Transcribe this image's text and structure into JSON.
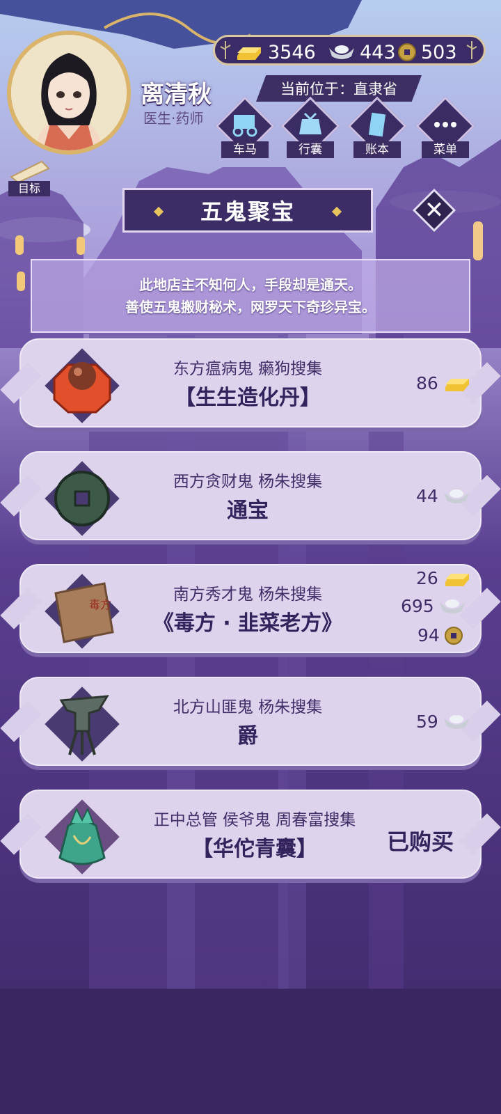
{
  "player": {
    "name": "离清秋",
    "role": "医生·药师"
  },
  "currency": {
    "gold": "3546",
    "silver": "443",
    "coin": "503"
  },
  "location": "当前位于：直隶省",
  "menu": [
    {
      "label": "车马",
      "icon": "carriage-icon"
    },
    {
      "label": "行囊",
      "icon": "bag-icon"
    },
    {
      "label": "账本",
      "icon": "ledger-icon"
    },
    {
      "label": "菜单",
      "icon": "menu-icon"
    }
  ],
  "goal_label": "目标",
  "shop": {
    "title": "五鬼聚宝",
    "description": [
      "此地店主不知何人，手段却是通天。",
      "善使五鬼搬财秘术，网罗天下奇珍异宝。"
    ]
  },
  "items": [
    {
      "subtitle": "东方瘟病鬼 癞狗搜集",
      "name": "【生生造化丹】",
      "icon": "pill-box-icon",
      "prices": [
        {
          "amount": "86",
          "currency": "gold"
        }
      ]
    },
    {
      "subtitle": "西方贪财鬼 杨朱搜集",
      "name": "通宝",
      "icon": "coin-icon",
      "prices": [
        {
          "amount": "44",
          "currency": "silver"
        }
      ]
    },
    {
      "subtitle": "南方秀才鬼 杨朱搜集",
      "name": "《毒方 · 韭菜老方》",
      "icon": "scroll-icon",
      "icon_text": "毒方",
      "prices": [
        {
          "amount": "26",
          "currency": "gold"
        },
        {
          "amount": "695",
          "currency": "silver"
        },
        {
          "amount": "94",
          "currency": "coin"
        }
      ]
    },
    {
      "subtitle": "北方山匪鬼 杨朱搜集",
      "name": "爵",
      "icon": "bronze-vessel-icon",
      "prices": [
        {
          "amount": "59",
          "currency": "silver"
        }
      ]
    },
    {
      "subtitle": "正中总管 侯爷鬼 周春富搜集",
      "name": "【华佗青囊】",
      "icon": "pouch-icon",
      "status": "已购买"
    }
  ]
}
